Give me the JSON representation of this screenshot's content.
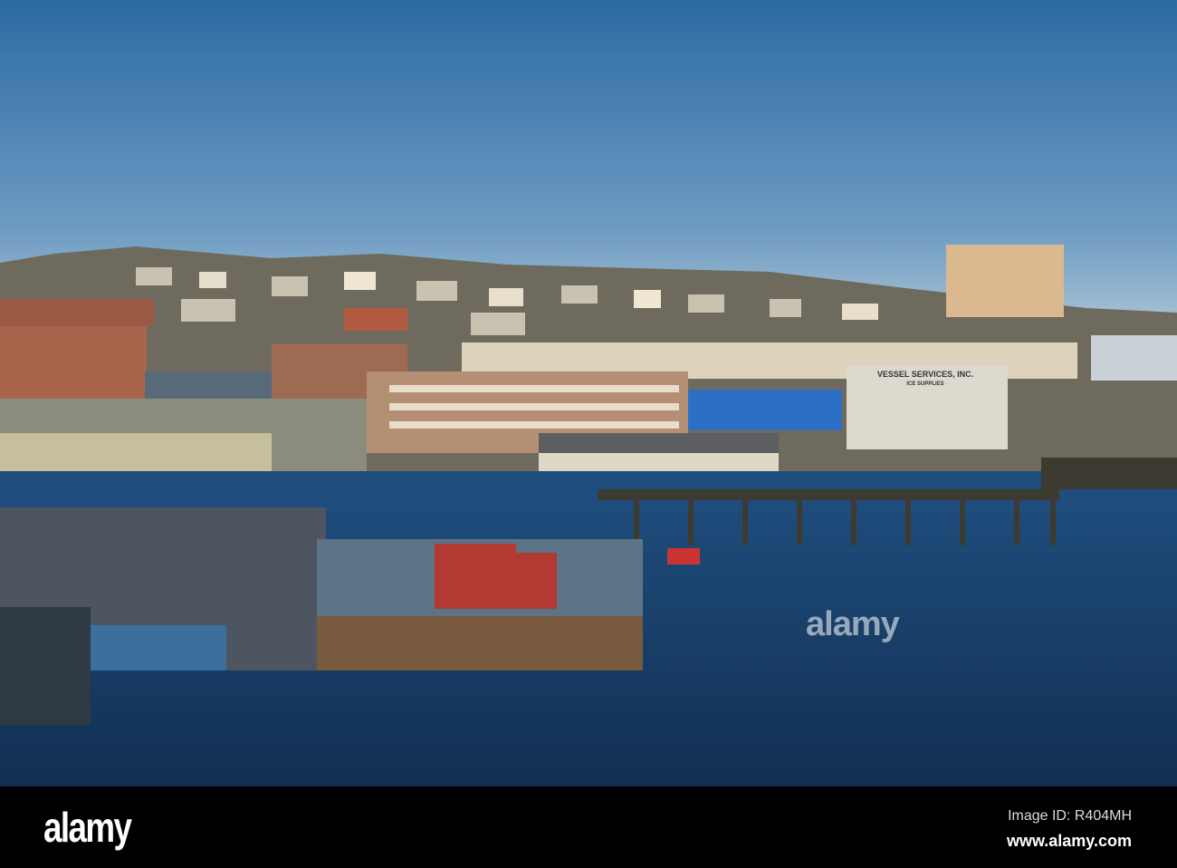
{
  "photo": {
    "sign_main": "VESSEL SERVICES, INC.",
    "sign_sub": "ICE SUPPLIES",
    "watermark": "alamy"
  },
  "footer": {
    "logo": "alamy",
    "image_id": "Image ID: R404MH",
    "website": "www.alamy.com"
  },
  "colors": {
    "sky_top": "#2c6aa3",
    "sky_horizon": "#a9c2d3",
    "water": "#163a62",
    "footer": "#000000"
  }
}
